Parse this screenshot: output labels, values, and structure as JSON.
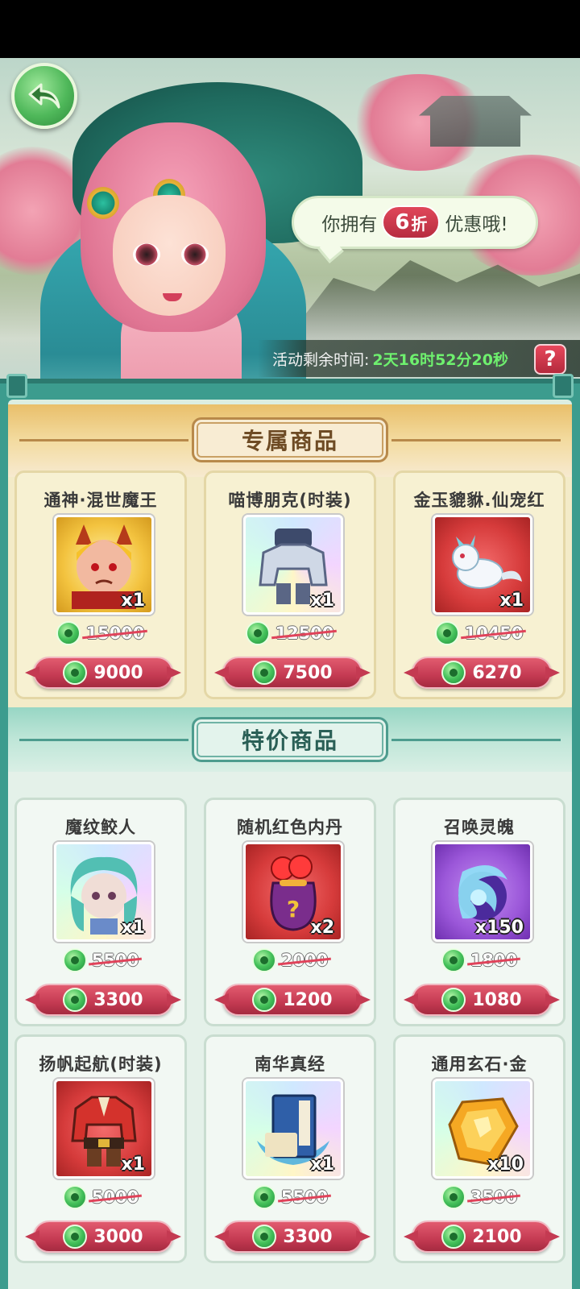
{
  "banner": {
    "speech_prefix": "你拥有",
    "discount_number": "6",
    "discount_unit": "折",
    "speech_suffix": "优惠哦!",
    "timer_label": "活动剩余时间:",
    "timer_value": "2天16时52分20秒",
    "help_label": "?"
  },
  "sections": {
    "exclusive_title": "专属商品",
    "special_title": "特价商品"
  },
  "exclusive_items": [
    {
      "name": "通神·混世魔王",
      "qty": "x1",
      "old_price": "15000",
      "price": "9000",
      "icon": "demon-king-icon"
    },
    {
      "name": "喵博朋克(时装)",
      "qty": "x1",
      "old_price": "12500",
      "price": "7500",
      "icon": "cyber-outfit-icon"
    },
    {
      "name": "金玉貔貅.仙宠红",
      "qty": "x1",
      "old_price": "10450",
      "price": "6270",
      "icon": "pixiu-pet-icon"
    }
  ],
  "special_items": [
    {
      "name": "魔纹鲛人",
      "qty": "x1",
      "old_price": "5500",
      "price": "3300",
      "icon": "merfolk-icon"
    },
    {
      "name": "随机红色内丹",
      "qty": "x2",
      "old_price": "2000",
      "price": "1200",
      "icon": "mystery-bag-icon"
    },
    {
      "name": "召唤灵魄",
      "qty": "x150",
      "old_price": "1800",
      "price": "1080",
      "icon": "spirit-orb-icon"
    },
    {
      "name": "扬帆起航(时装)",
      "qty": "x1",
      "old_price": "5000",
      "price": "3000",
      "icon": "sailor-outfit-icon"
    },
    {
      "name": "南华真经",
      "qty": "x1",
      "old_price": "5500",
      "price": "3300",
      "icon": "scripture-book-icon"
    },
    {
      "name": "通用玄石·金",
      "qty": "x10",
      "old_price": "3500",
      "price": "2100",
      "icon": "gold-stone-icon"
    }
  ],
  "colors": {
    "teal_frame": "#3c9c8e",
    "price_button": "#c43a52",
    "timer_green": "#6ef06e",
    "jade_currency": "#45c25b"
  }
}
